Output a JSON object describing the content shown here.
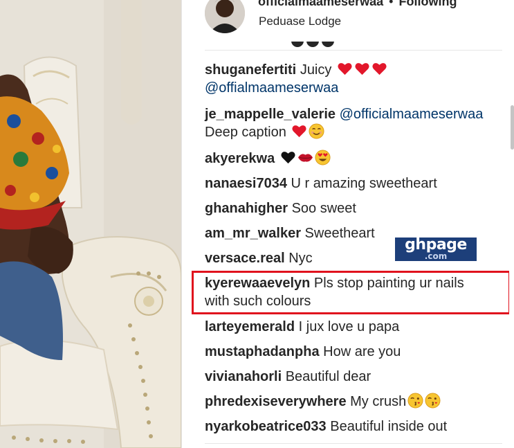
{
  "post": {
    "username": "officialmaameserwaa",
    "separator": "•",
    "follow_status": "Following",
    "location": "Peduase Lodge"
  },
  "comments": [
    {
      "user": "shuganefertiti",
      "text": "Juicy",
      "emoji": [
        "heart",
        "heart",
        "heart"
      ],
      "text2": "@offialmaameserwaa"
    },
    {
      "user": "je_mappelle_valerie",
      "mention": "@officialmaameserwaa",
      "text": "Deep caption",
      "emoji": [
        "heart",
        "smile"
      ]
    },
    {
      "user": "akyerekwa",
      "text": "",
      "emoji": [
        "black-heart",
        "lips",
        "heart-eyes"
      ]
    },
    {
      "user": "nanaesi7034",
      "text": "U r amazing sweetheart"
    },
    {
      "user": "ghanahigher",
      "text": "Soo sweet"
    },
    {
      "user": "am_mr_walker",
      "text": "Sweetheart"
    },
    {
      "user": "versace.real",
      "text": "Nyc"
    },
    {
      "user": "kyerewaaevelyn",
      "text": "Pls stop painting ur nails",
      "text2": "with such colours"
    },
    {
      "user": "larteyemerald",
      "text": "I jux love u papa"
    },
    {
      "user": "mustaphadanpha",
      "text": "How are you"
    },
    {
      "user": "vivianahorli",
      "text": "Beautiful dear"
    },
    {
      "user": "phredexiseverywhere",
      "text": "My crush",
      "emoji": [
        "wink-kiss",
        "wink-kiss"
      ]
    },
    {
      "user": "nyarkobeatrice033",
      "text": "Beautiful inside out"
    }
  ],
  "watermark": {
    "line1": "ghpage",
    "line2": ".com"
  },
  "colors": {
    "highlight": "#e0121d",
    "mention": "#003569",
    "watermark_bg": "#1d3f7a"
  }
}
